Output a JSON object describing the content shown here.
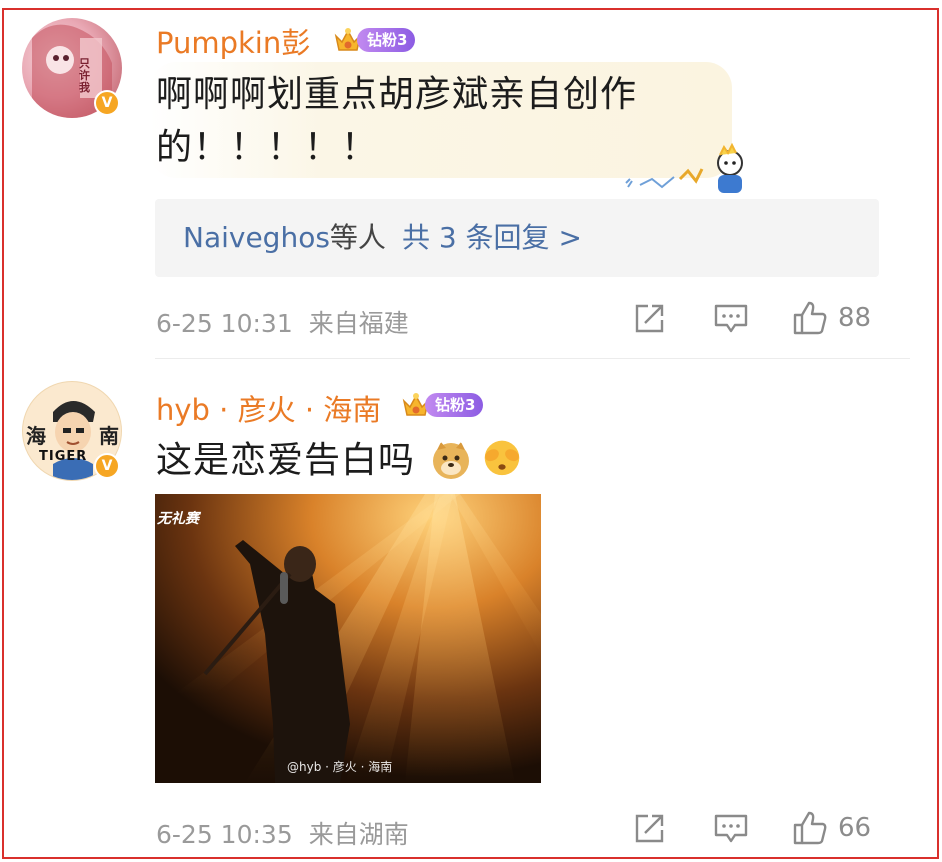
{
  "comments": [
    {
      "username": "Pumpkin彭",
      "fan_badge": "钻粉3",
      "text_line1": "啊啊啊划重点胡彦斌亲自创作",
      "text_line2": "的！！！！！",
      "replies": {
        "names": "Naiveghos",
        "suffix": "等人",
        "count": "共 3 条回复 >"
      },
      "time": "6-25 10:31",
      "location": "来自福建",
      "likes": "88",
      "avatar_text": "只许我"
    },
    {
      "username": "hyb · 彦火 · 海南",
      "fan_badge": "钻粉3",
      "text": "这是恋爱告白吗",
      "emojis": [
        "doge-emoji",
        "covering-eyes-emoji"
      ],
      "image_watermark": "@hyb · 彦火 · 海南",
      "image_title": "无礼赛",
      "time": "6-25 10:35",
      "location": "来自湖南",
      "likes": "66",
      "avatar_text_left": "海",
      "avatar_text_right": "南",
      "avatar_text_bottom": "TIGER"
    }
  ],
  "verified_mark": "V"
}
